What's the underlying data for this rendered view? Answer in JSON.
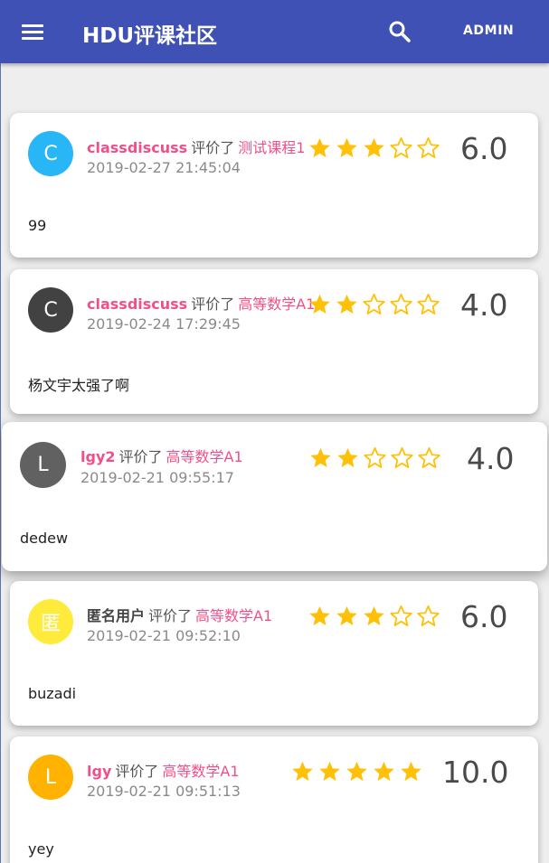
{
  "app": {
    "title": "HDU评课社区",
    "admin_label": "ADMIN",
    "primary_color": "#3f51b5",
    "accent_color": "#f0508a",
    "star_color": "#ffc107"
  },
  "reviews": [
    {
      "user": "classdiscuss",
      "avatar_letter": "C",
      "avatar_color": "#29b6f6",
      "verb": "评价了",
      "course": "测试课程1",
      "time": "2019-02-27 21:45:04",
      "rating_stars": 3,
      "score": "6.0",
      "comment": "99"
    },
    {
      "user": "classdiscuss",
      "avatar_letter": "C",
      "avatar_color": "#424242",
      "verb": "评价了",
      "course": "高等数学A1",
      "time": "2019-02-24 17:29:45",
      "rating_stars": 2,
      "score": "4.0",
      "comment": "杨文宇太强了啊"
    },
    {
      "user": "lgy2",
      "avatar_letter": "L",
      "avatar_color": "#616161",
      "verb": "评价了",
      "course": "高等数学A1",
      "time": "2019-02-21 09:55:17",
      "rating_stars": 2,
      "score": "4.0",
      "comment": "dedew"
    },
    {
      "user": "匿名用户",
      "avatar_letter": "匿",
      "avatar_color": "#ffeb3b",
      "verb": "评价了",
      "course": "高等数学A1",
      "time": "2019-02-21 09:52:10",
      "rating_stars": 3,
      "score": "6.0",
      "comment": "buzadi",
      "anonymous": true
    },
    {
      "user": "lgy",
      "avatar_letter": "L",
      "avatar_color": "#ffb300",
      "verb": "评价了",
      "course": "高等数学A1",
      "time": "2019-02-21 09:51:13",
      "rating_stars": 5,
      "score": "10.0",
      "comment": "yey"
    }
  ]
}
